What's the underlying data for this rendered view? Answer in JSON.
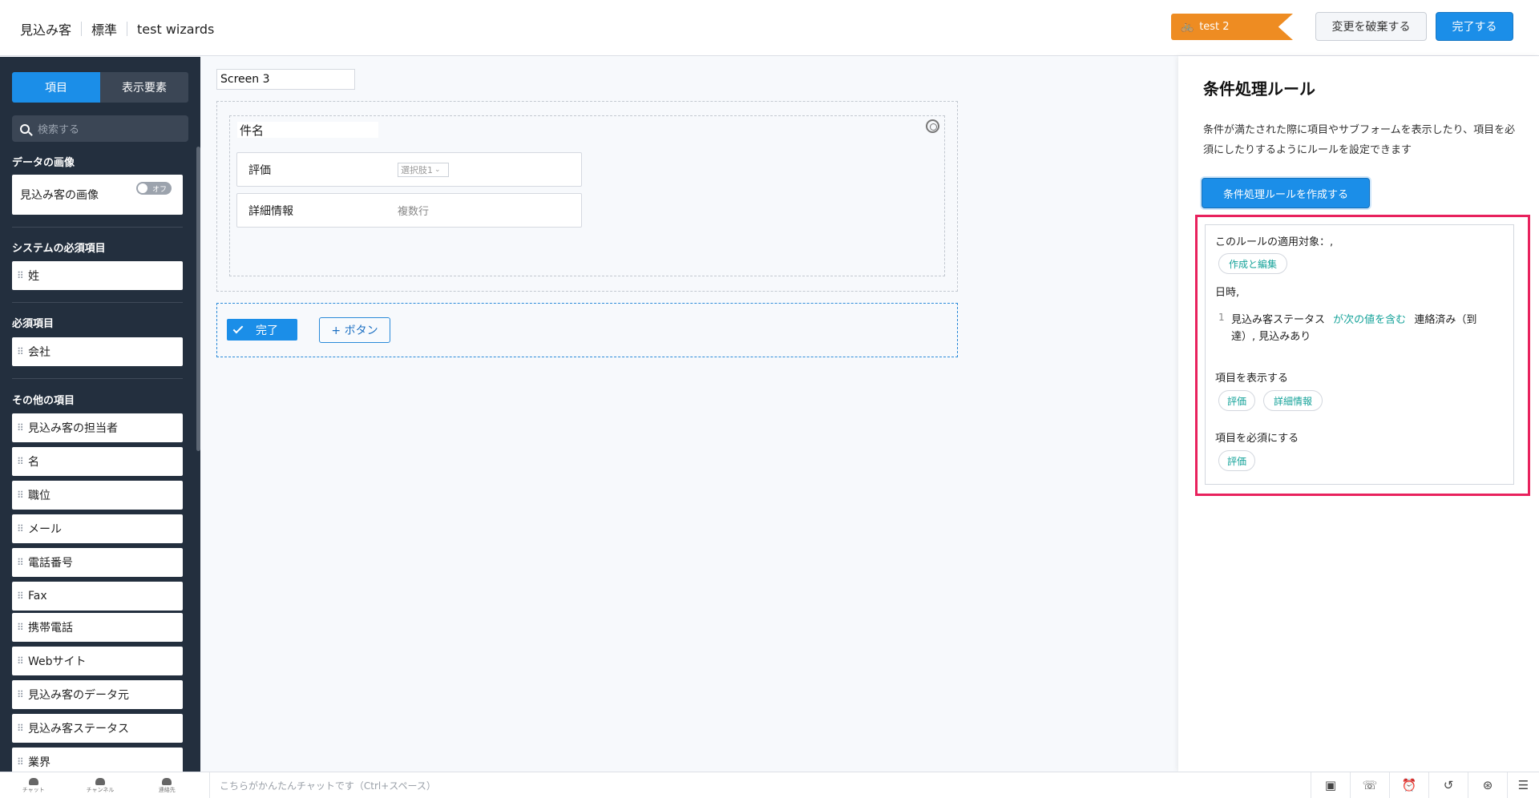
{
  "header": {
    "breadcrumbs": [
      "見込み客",
      "標準",
      "test wizards"
    ],
    "ribbon_label": "test 2",
    "discard_label": "変更を破棄する",
    "done_label": "完了する"
  },
  "sidebar": {
    "tabs": [
      "項目",
      "表示要素"
    ],
    "search_placeholder": "検索する",
    "sections": {
      "data_image": {
        "title": "データの画像",
        "field": "見込み客の画像",
        "toggle": "オフ"
      },
      "system_required": {
        "title": "システムの必須項目",
        "fields": [
          "姓"
        ]
      },
      "required": {
        "title": "必須項目",
        "fields": [
          "会社"
        ]
      },
      "other": {
        "title": "その他の項目",
        "fields": [
          "見込み客の担当者",
          "名",
          "職位",
          "メール",
          "電話番号",
          "Fax",
          "携帯電話",
          "Webサイト",
          "見込み客のデータ元",
          "見込み客ステータス",
          "業界"
        ]
      }
    }
  },
  "canvas": {
    "screen_name": "Screen 3",
    "section_name": "件名",
    "fields": [
      {
        "label": "評価",
        "control": "選択肢1"
      },
      {
        "label": "詳細情報",
        "control": "複数行"
      }
    ],
    "complete_button": "完了",
    "add_button": "+ ボタン"
  },
  "right_panel": {
    "title": "条件処理ルール",
    "description": "条件が満たされた際に項目やサブフォームを表示したり、項目を必須にしたりするようにルールを設定できます",
    "create_button": "条件処理ルールを作成する",
    "rule": {
      "applies_to_label": "このルールの適用対象：,",
      "applies_to_chip": "作成と編集",
      "when_label": "日時,",
      "condition_number": "1",
      "condition_field": "見込み客ステータス",
      "condition_operator": "が次の値を含む",
      "condition_value_1": "連絡済み（到",
      "condition_value_2": "達）, 見込みあり",
      "show_label": "項目を表示する",
      "show_chips": [
        "評価",
        "詳細情報"
      ],
      "required_label": "項目を必須にする",
      "required_chips": [
        "評価"
      ]
    }
  },
  "bottom_bar": {
    "nav": [
      "チャット",
      "チャンネル",
      "連絡先"
    ],
    "chat_placeholder": "こちらがかんたんチャットです（Ctrl+スペース）",
    "icons": [
      "screen-icon",
      "call-icon",
      "alarm-icon",
      "history-icon",
      "accessibility-icon",
      "notes-icon"
    ]
  },
  "colors": {
    "accent": "#1b8ee8",
    "sidebar": "#232f3e",
    "ribbon": "#ee8c22",
    "highlight": "#e8215d",
    "teal": "#16a39a"
  }
}
